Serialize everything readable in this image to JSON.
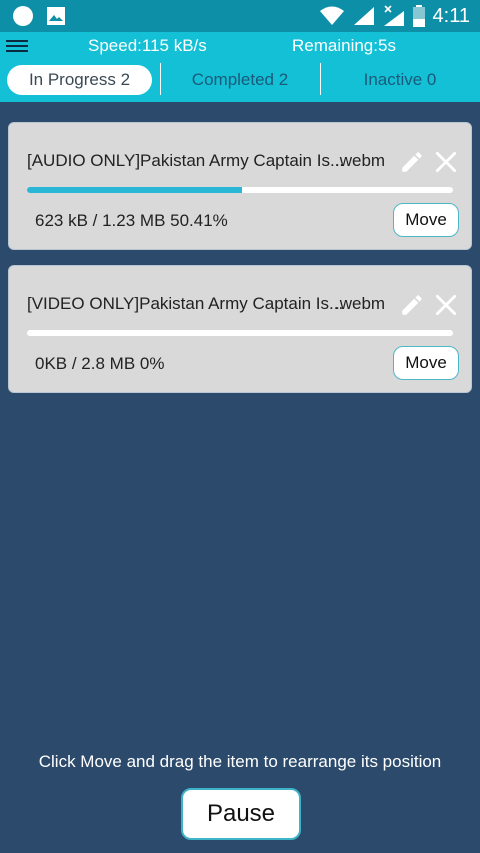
{
  "status_bar": {
    "time": "4:11",
    "icons": [
      "circle-notification-icon",
      "image-notification-icon",
      "wifi-icon",
      "cell-signal-icon",
      "no-signal-icon",
      "battery-icon"
    ]
  },
  "header": {
    "speed": "Speed:115 kB/s",
    "remaining": "Remaining:5s",
    "tabs": [
      {
        "label": "In Progress 2",
        "active": true
      },
      {
        "label": "Completed 2",
        "active": false
      },
      {
        "label": "Inactive 0",
        "active": false
      }
    ]
  },
  "downloads": [
    {
      "name": "[AUDIO ONLY]Pakistan Army Captain Is...",
      "extension": ".webm",
      "size_text": "623 kB / 1.23 MB 50.41%",
      "progress": 0.5041,
      "move_label": "Move"
    },
    {
      "name": "[VIDEO ONLY]Pakistan Army Captain Is...",
      "extension": ".webm",
      "size_text": "0KB / 2.8 MB 0%",
      "progress": 0,
      "move_label": "Move"
    }
  ],
  "footer": {
    "hint": "Click Move and drag the item to rearrange its position",
    "pause_label": "Pause"
  },
  "colors": {
    "background": "#2c4a6b",
    "header": "#14c0d6",
    "status_bar": "#0e8fa8",
    "progress": "#2ab6d6"
  }
}
